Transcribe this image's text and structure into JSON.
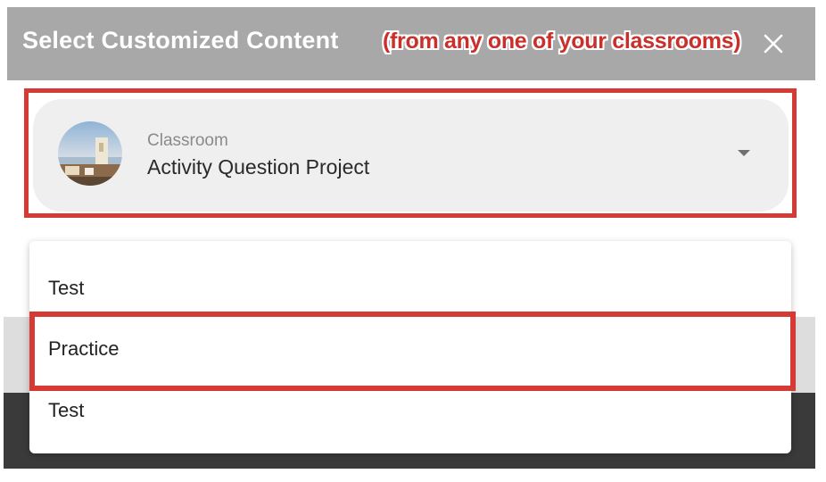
{
  "header": {
    "title": "Select Customized Content",
    "note": "(from any one of your classrooms)",
    "close_icon": "close-icon"
  },
  "classroom_select": {
    "label": "Classroom",
    "value": "Activity Question Project",
    "avatar_icon": "classroom-avatar",
    "arrow_icon": "dropdown-arrow-icon"
  },
  "options": [
    {
      "label": "Test"
    },
    {
      "label": "Practice"
    },
    {
      "label": "Test"
    }
  ],
  "colors": {
    "header_bg": "#a8a8a8",
    "highlight": "#d63a35",
    "select_bg": "#efefef"
  }
}
